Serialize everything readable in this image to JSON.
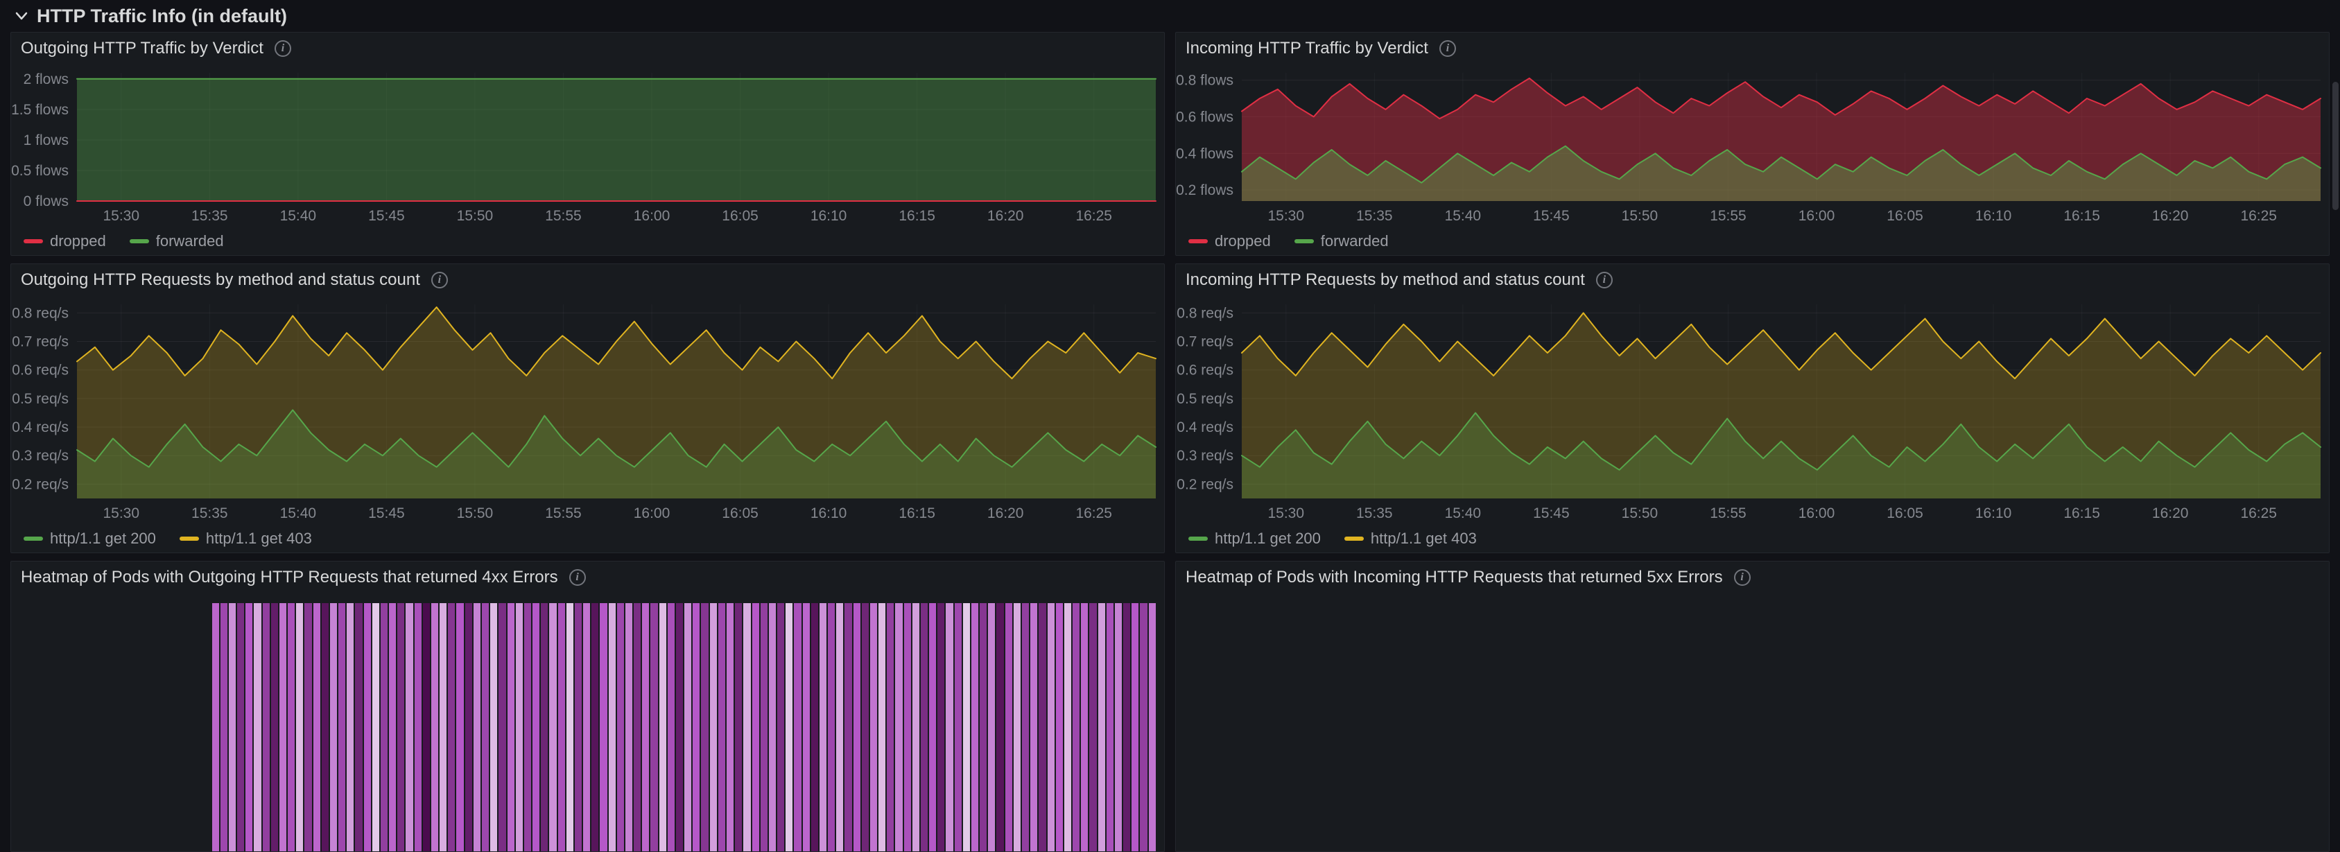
{
  "section": {
    "title": "HTTP Traffic Info (in default)"
  },
  "icons": {
    "info_glyph": "i"
  },
  "chart_data": [
    {
      "type": "area",
      "title": "Outgoing HTTP Traffic by Verdict",
      "ylabel": "flows",
      "ylim": [
        0,
        2.1
      ],
      "x_domain": [
        927.5,
        988.5
      ],
      "x_ticks": [
        {
          "label": "15:30",
          "min": 930
        },
        {
          "label": "15:35",
          "min": 935
        },
        {
          "label": "15:40",
          "min": 940
        },
        {
          "label": "15:45",
          "min": 945
        },
        {
          "label": "15:50",
          "min": 950
        },
        {
          "label": "15:55",
          "min": 955
        },
        {
          "label": "16:00",
          "min": 960
        },
        {
          "label": "16:05",
          "min": 965
        },
        {
          "label": "16:10",
          "min": 970
        },
        {
          "label": "16:15",
          "min": 975
        },
        {
          "label": "16:20",
          "min": 980
        },
        {
          "label": "16:25",
          "min": 985
        }
      ],
      "y_ticks": [
        {
          "v": 0,
          "label": "0 flows"
        },
        {
          "v": 0.5,
          "label": "0.5 flows"
        },
        {
          "v": 1,
          "label": "1 flows"
        },
        {
          "v": 1.5,
          "label": "1.5 flows"
        },
        {
          "v": 2,
          "label": "2 flows"
        }
      ],
      "legend": [
        {
          "label": "dropped",
          "color": "#e02f44"
        },
        {
          "label": "forwarded",
          "color": "#56a64b"
        }
      ],
      "series": [
        {
          "name": "forwarded",
          "color": "#56a64b",
          "fill_opacity": 0.38,
          "values": [
            2,
            2,
            2,
            2,
            2,
            2,
            2,
            2,
            2,
            2,
            2,
            2,
            2
          ]
        },
        {
          "name": "dropped",
          "color": "#e02f44",
          "fill_opacity": 0,
          "values": [
            0,
            0,
            0,
            0,
            0,
            0,
            0,
            0,
            0,
            0,
            0,
            0,
            0
          ]
        }
      ]
    },
    {
      "type": "area",
      "title": "Incoming HTTP Traffic by Verdict",
      "ylabel": "flows",
      "ylim": [
        0.14,
        0.84
      ],
      "x_domain": [
        927.5,
        988.5
      ],
      "x_ticks": [
        {
          "label": "15:30",
          "min": 930
        },
        {
          "label": "15:35",
          "min": 935
        },
        {
          "label": "15:40",
          "min": 940
        },
        {
          "label": "15:45",
          "min": 945
        },
        {
          "label": "15:50",
          "min": 950
        },
        {
          "label": "15:55",
          "min": 955
        },
        {
          "label": "16:00",
          "min": 960
        },
        {
          "label": "16:05",
          "min": 965
        },
        {
          "label": "16:10",
          "min": 970
        },
        {
          "label": "16:15",
          "min": 975
        },
        {
          "label": "16:20",
          "min": 980
        },
        {
          "label": "16:25",
          "min": 985
        }
      ],
      "y_ticks": [
        {
          "v": 0.2,
          "label": "0.2 flows"
        },
        {
          "v": 0.4,
          "label": "0.4 flows"
        },
        {
          "v": 0.6,
          "label": "0.6 flows"
        },
        {
          "v": 0.8,
          "label": "0.8 flows"
        }
      ],
      "legend": [
        {
          "label": "dropped",
          "color": "#e02f44"
        },
        {
          "label": "forwarded",
          "color": "#56a64b"
        }
      ],
      "series": [
        {
          "name": "dropped",
          "color": "#e02f44",
          "fill_opacity": 0.42,
          "values": [
            0.63,
            0.7,
            0.75,
            0.66,
            0.6,
            0.71,
            0.78,
            0.7,
            0.64,
            0.72,
            0.66,
            0.59,
            0.64,
            0.72,
            0.68,
            0.75,
            0.81,
            0.73,
            0.66,
            0.71,
            0.64,
            0.7,
            0.76,
            0.68,
            0.62,
            0.7,
            0.66,
            0.73,
            0.79,
            0.71,
            0.65,
            0.72,
            0.68,
            0.61,
            0.67,
            0.74,
            0.7,
            0.64,
            0.7,
            0.77,
            0.71,
            0.66,
            0.72,
            0.67,
            0.74,
            0.68,
            0.62,
            0.7,
            0.66,
            0.72,
            0.78,
            0.7,
            0.64,
            0.68,
            0.74,
            0.7,
            0.66,
            0.72,
            0.68,
            0.64,
            0.7
          ]
        },
        {
          "name": "forwarded",
          "color": "#56a64b",
          "fill_opacity": 0.42,
          "values": [
            0.3,
            0.38,
            0.32,
            0.26,
            0.35,
            0.42,
            0.34,
            0.28,
            0.36,
            0.3,
            0.24,
            0.32,
            0.4,
            0.34,
            0.28,
            0.35,
            0.3,
            0.38,
            0.44,
            0.36,
            0.3,
            0.26,
            0.34,
            0.4,
            0.32,
            0.28,
            0.36,
            0.42,
            0.34,
            0.3,
            0.38,
            0.32,
            0.26,
            0.34,
            0.3,
            0.38,
            0.32,
            0.28,
            0.36,
            0.42,
            0.34,
            0.28,
            0.34,
            0.4,
            0.32,
            0.28,
            0.36,
            0.3,
            0.26,
            0.34,
            0.4,
            0.34,
            0.28,
            0.36,
            0.32,
            0.38,
            0.3,
            0.26,
            0.34,
            0.38,
            0.32
          ]
        }
      ]
    },
    {
      "type": "line",
      "title": "Outgoing HTTP Requests by method and status count",
      "ylabel": "req/s",
      "ylim": [
        0.15,
        0.83
      ],
      "x_domain": [
        927.5,
        988.5
      ],
      "x_ticks": [
        {
          "label": "15:30",
          "min": 930
        },
        {
          "label": "15:35",
          "min": 935
        },
        {
          "label": "15:40",
          "min": 940
        },
        {
          "label": "15:45",
          "min": 945
        },
        {
          "label": "15:50",
          "min": 950
        },
        {
          "label": "15:55",
          "min": 955
        },
        {
          "label": "16:00",
          "min": 960
        },
        {
          "label": "16:05",
          "min": 965
        },
        {
          "label": "16:10",
          "min": 970
        },
        {
          "label": "16:15",
          "min": 975
        },
        {
          "label": "16:20",
          "min": 980
        },
        {
          "label": "16:25",
          "min": 985
        }
      ],
      "y_ticks": [
        {
          "v": 0.2,
          "label": "0.2 req/s"
        },
        {
          "v": 0.3,
          "label": "0.3 req/s"
        },
        {
          "v": 0.4,
          "label": "0.4 req/s"
        },
        {
          "v": 0.5,
          "label": "0.5 req/s"
        },
        {
          "v": 0.6,
          "label": "0.6 req/s"
        },
        {
          "v": 0.7,
          "label": "0.7 req/s"
        },
        {
          "v": 0.8,
          "label": "0.8 req/s"
        }
      ],
      "legend": [
        {
          "label": "http/1.1 get 200",
          "color": "#56a64b"
        },
        {
          "label": "http/1.1 get 403",
          "color": "#e0b421"
        }
      ],
      "series": [
        {
          "name": "http/1.1 get 403",
          "color": "#e0b421",
          "fill_opacity": 0.25,
          "values": [
            0.63,
            0.68,
            0.6,
            0.65,
            0.72,
            0.66,
            0.58,
            0.64,
            0.74,
            0.69,
            0.62,
            0.7,
            0.79,
            0.71,
            0.65,
            0.73,
            0.67,
            0.6,
            0.68,
            0.75,
            0.82,
            0.74,
            0.67,
            0.73,
            0.64,
            0.58,
            0.66,
            0.72,
            0.67,
            0.62,
            0.7,
            0.77,
            0.69,
            0.62,
            0.68,
            0.74,
            0.66,
            0.6,
            0.68,
            0.63,
            0.7,
            0.64,
            0.57,
            0.66,
            0.73,
            0.66,
            0.72,
            0.79,
            0.7,
            0.64,
            0.7,
            0.63,
            0.57,
            0.64,
            0.7,
            0.66,
            0.73,
            0.66,
            0.59,
            0.66,
            0.64
          ]
        },
        {
          "name": "http/1.1 get 200",
          "color": "#56a64b",
          "fill_opacity": 0.28,
          "values": [
            0.32,
            0.28,
            0.36,
            0.3,
            0.26,
            0.34,
            0.41,
            0.33,
            0.28,
            0.34,
            0.3,
            0.38,
            0.46,
            0.38,
            0.32,
            0.28,
            0.34,
            0.3,
            0.36,
            0.3,
            0.26,
            0.32,
            0.38,
            0.32,
            0.26,
            0.34,
            0.44,
            0.36,
            0.3,
            0.36,
            0.3,
            0.26,
            0.32,
            0.38,
            0.3,
            0.26,
            0.34,
            0.28,
            0.34,
            0.4,
            0.32,
            0.28,
            0.34,
            0.3,
            0.36,
            0.42,
            0.34,
            0.28,
            0.34,
            0.28,
            0.36,
            0.3,
            0.26,
            0.32,
            0.38,
            0.32,
            0.28,
            0.34,
            0.3,
            0.37,
            0.33
          ]
        }
      ]
    },
    {
      "type": "line",
      "title": "Incoming HTTP Requests by method and status count",
      "ylabel": "req/s",
      "ylim": [
        0.15,
        0.83
      ],
      "x_domain": [
        927.5,
        988.5
      ],
      "x_ticks": [
        {
          "label": "15:30",
          "min": 930
        },
        {
          "label": "15:35",
          "min": 935
        },
        {
          "label": "15:40",
          "min": 940
        },
        {
          "label": "15:45",
          "min": 945
        },
        {
          "label": "15:50",
          "min": 950
        },
        {
          "label": "15:55",
          "min": 955
        },
        {
          "label": "16:00",
          "min": 960
        },
        {
          "label": "16:05",
          "min": 965
        },
        {
          "label": "16:10",
          "min": 970
        },
        {
          "label": "16:15",
          "min": 975
        },
        {
          "label": "16:20",
          "min": 980
        },
        {
          "label": "16:25",
          "min": 985
        }
      ],
      "y_ticks": [
        {
          "v": 0.2,
          "label": "0.2 req/s"
        },
        {
          "v": 0.3,
          "label": "0.3 req/s"
        },
        {
          "v": 0.4,
          "label": "0.4 req/s"
        },
        {
          "v": 0.5,
          "label": "0.5 req/s"
        },
        {
          "v": 0.6,
          "label": "0.6 req/s"
        },
        {
          "v": 0.7,
          "label": "0.7 req/s"
        },
        {
          "v": 0.8,
          "label": "0.8 req/s"
        }
      ],
      "legend": [
        {
          "label": "http/1.1 get 200",
          "color": "#56a64b"
        },
        {
          "label": "http/1.1 get 403",
          "color": "#e0b421"
        }
      ],
      "series": [
        {
          "name": "http/1.1 get 403",
          "color": "#e0b421",
          "fill_opacity": 0.25,
          "values": [
            0.66,
            0.72,
            0.64,
            0.58,
            0.66,
            0.73,
            0.67,
            0.61,
            0.69,
            0.76,
            0.7,
            0.63,
            0.7,
            0.64,
            0.58,
            0.65,
            0.72,
            0.66,
            0.72,
            0.8,
            0.72,
            0.65,
            0.71,
            0.64,
            0.7,
            0.76,
            0.68,
            0.62,
            0.68,
            0.74,
            0.67,
            0.6,
            0.67,
            0.73,
            0.66,
            0.6,
            0.66,
            0.72,
            0.78,
            0.7,
            0.64,
            0.7,
            0.63,
            0.57,
            0.64,
            0.71,
            0.65,
            0.71,
            0.78,
            0.71,
            0.64,
            0.7,
            0.64,
            0.58,
            0.65,
            0.71,
            0.66,
            0.72,
            0.66,
            0.6,
            0.66
          ]
        },
        {
          "name": "http/1.1 get 200",
          "color": "#56a64b",
          "fill_opacity": 0.28,
          "values": [
            0.3,
            0.26,
            0.33,
            0.39,
            0.31,
            0.27,
            0.35,
            0.42,
            0.34,
            0.29,
            0.35,
            0.3,
            0.37,
            0.45,
            0.37,
            0.31,
            0.27,
            0.33,
            0.29,
            0.35,
            0.29,
            0.25,
            0.31,
            0.37,
            0.31,
            0.27,
            0.35,
            0.43,
            0.35,
            0.29,
            0.35,
            0.29,
            0.25,
            0.31,
            0.37,
            0.3,
            0.26,
            0.33,
            0.28,
            0.34,
            0.41,
            0.33,
            0.28,
            0.34,
            0.29,
            0.35,
            0.41,
            0.33,
            0.28,
            0.33,
            0.28,
            0.35,
            0.3,
            0.26,
            0.32,
            0.38,
            0.32,
            0.28,
            0.34,
            0.38,
            0.33
          ]
        }
      ]
    },
    {
      "type": "heatmap",
      "title": "Heatmap of Pods with Outgoing HTTP Requests that returned 4xx Errors",
      "x_start_frac": 0.125,
      "color_stops": [
        {
          "p": 0,
          "color": "#efe6f0"
        },
        {
          "p": 0.5,
          "color": "#b558c8"
        },
        {
          "p": 1,
          "color": "#3f0440"
        }
      ],
      "values": [
        0.45,
        0.6,
        0.3,
        0.75,
        0.5,
        0.2,
        0.65,
        0.85,
        0.4,
        0.55,
        0.15,
        0.7,
        0.45,
        0.9,
        0.35,
        0.6,
        0.25,
        0.8,
        0.5,
        0.1,
        0.65,
        0.45,
        0.75,
        0.3,
        0.55,
        0.95,
        0.4,
        0.2,
        0.7,
        0.5,
        0.85,
        0.35,
        0.6,
        0.15,
        0.75,
        0.45,
        0.25,
        0.65,
        0.5,
        0.8,
        0.3,
        0.55,
        0.1,
        0.7,
        0.4,
        0.9,
        0.5,
        0.2,
        0.6,
        0.35,
        0.75,
        0.45,
        0.65,
        0.15,
        0.55,
        0.85,
        0.3,
        0.5,
        0.7,
        0.25,
        0.6,
        0.4,
        0.8,
        0.2,
        0.5,
        0.65,
        0.35,
        0.75,
        0.1,
        0.55,
        0.45,
        0.9,
        0.3,
        0.6,
        0.2,
        0.7,
        0.5,
        0.8,
        0.4,
        0.15,
        0.65,
        0.35,
        0.55,
        0.25,
        0.75,
        0.5,
        0.85,
        0.3,
        0.6,
        0.1,
        0.45,
        0.7,
        0.35,
        0.9,
        0.55,
        0.2,
        0.65,
        0.4,
        0.8,
        0.3,
        0.5,
        0.15,
        0.6,
        0.45,
        0.75,
        0.25,
        0.55,
        0.35,
        0.85,
        0.5,
        0.65,
        0.4
      ]
    },
    {
      "type": "empty",
      "title": "Heatmap of Pods with Incoming HTTP Requests that returned 5xx Errors"
    }
  ]
}
